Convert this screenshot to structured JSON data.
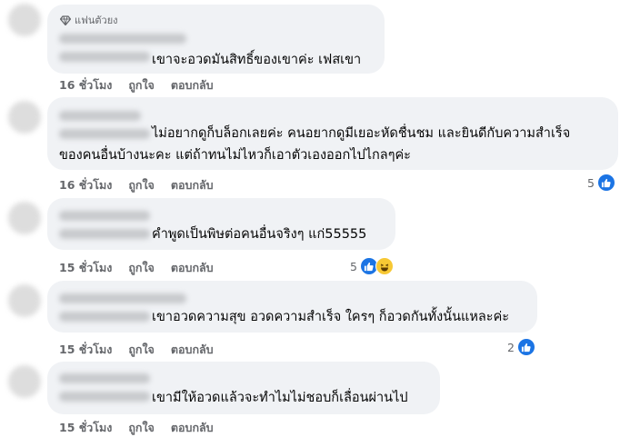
{
  "comments": [
    {
      "badge": "แฟนตัวยง",
      "text_lines": [
        "เขาจะอวดมันสิทธิ์ของเขาค่ะ เฟสเขา"
      ],
      "time": "16 ชั่วโมง",
      "like_label": "ถูกใจ",
      "reply_label": "ตอบกลับ",
      "reaction_count": "",
      "reactions": []
    },
    {
      "badge": "",
      "text_lines": [
        "ไม่อยากดูก็บล็อกเลยค่ะ คนอยากดูมีเยอะหัดชื่นชม และยินดีกับความสำเร็จ",
        "ของคนอื่นบ้างนะคะ แต่ถ้าทนไม่ไหวก็เอาตัวเองออกไปไกลๆค่ะ"
      ],
      "time": "16 ชั่วโมง",
      "like_label": "ถูกใจ",
      "reply_label": "ตอบกลับ",
      "reaction_count": "5",
      "reactions": [
        "like-icon"
      ]
    },
    {
      "badge": "",
      "text_lines": [
        "คำพูดเป็นพิษต่อคนอื่นจริงๆ แก่55555"
      ],
      "time": "15 ชั่วโมง",
      "like_label": "ถูกใจ",
      "reply_label": "ตอบกลับ",
      "reaction_count": "5",
      "reactions": [
        "like-icon",
        "haha-icon"
      ]
    },
    {
      "badge": "",
      "text_lines": [
        "เขาอวดความสุข อวดความสำเร็จ ใครๆ ก็อวดกันทั้งนั้นแหละค่ะ"
      ],
      "time": "15 ชั่วโมง",
      "like_label": "ถูกใจ",
      "reply_label": "ตอบกลับ",
      "reaction_count": "2",
      "reactions": [
        "like-icon"
      ]
    },
    {
      "badge": "",
      "text_lines": [
        "เขามีให้อวดแล้วจะทำไมไม่ชอบก็เลื่อนผ่านไป"
      ],
      "time": "15 ชั่วโมง",
      "like_label": "ถูกใจ",
      "reply_label": "ตอบกลับ",
      "reaction_count": "",
      "reactions": []
    }
  ],
  "colors": {
    "bubble": "#f0f2f5",
    "meta": "#65676b",
    "like": "#1b74e4",
    "haha": "#f7c834"
  }
}
